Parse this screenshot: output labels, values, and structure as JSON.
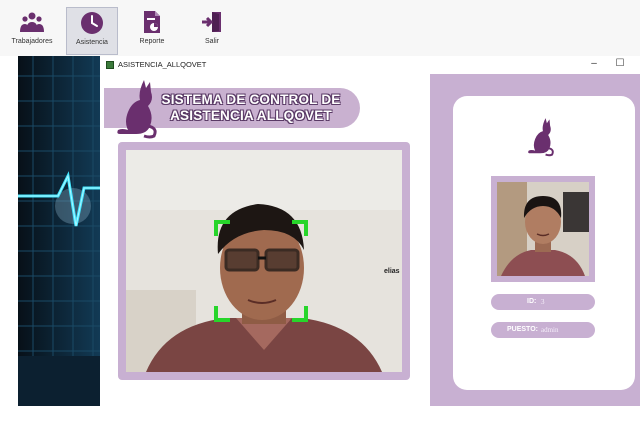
{
  "ribbon": {
    "buttons": [
      {
        "label": "Trabajadores",
        "icon": "workers-icon",
        "active": false
      },
      {
        "label": "Asistencia",
        "icon": "clock-icon",
        "active": true
      },
      {
        "label": "Reporte",
        "icon": "report-icon",
        "active": false
      },
      {
        "label": "Salir",
        "icon": "exit-icon",
        "active": false
      }
    ]
  },
  "window": {
    "title": "ASISTENCIA_ALLQOVET",
    "minimize": "–",
    "maximize": "☐"
  },
  "banner": {
    "line1": "SISTEMA DE CONTROL DE",
    "line2": "ASISTENCIA ALLQOVET"
  },
  "camera": {
    "detected_name": "elias"
  },
  "profile": {
    "id_label": "ID:",
    "id_value": "3",
    "puesto_label": "PUESTO:",
    "puesto_value": "admin"
  },
  "colors": {
    "accent": "#c8b0d2",
    "logo": "#6a2f6e",
    "detect": "#27d52a"
  }
}
